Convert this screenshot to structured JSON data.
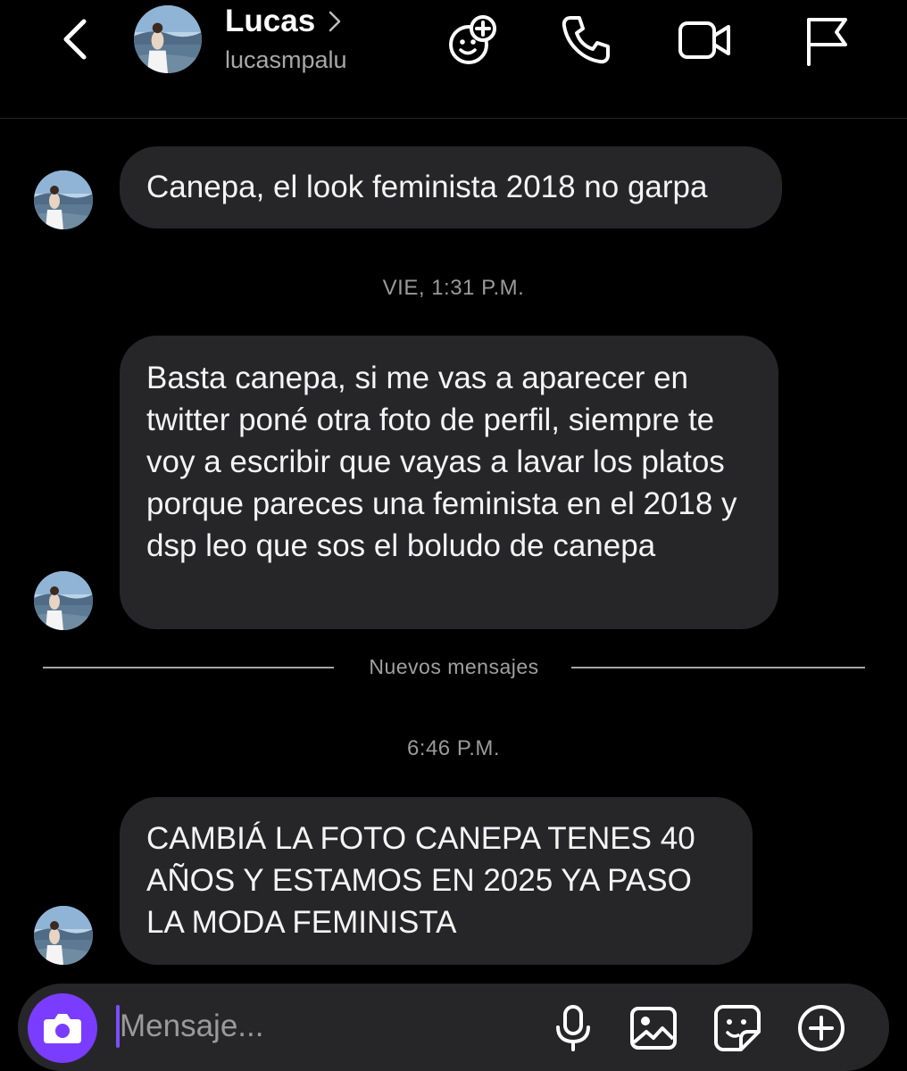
{
  "header": {
    "name": "Lucas",
    "username": "lucasmpalu",
    "icons": [
      "back-chevron-icon",
      "name-chevron-icon",
      "effects-icon",
      "phone-icon",
      "video-icon",
      "flag-icon"
    ]
  },
  "messages": [
    {
      "text": "Canepa, el look feminista 2018 no garpa"
    },
    {
      "text": "Basta canepa, si me vas a aparecer en twitter poné otra foto de perfil, siempre te voy a escribir que vayas a lavar los platos porque pareces una feminista en el 2018 y dsp leo que sos el boludo de canepa"
    },
    {
      "text": "CAMBIÁ LA FOTO CANEPA TENES 40 AÑOS Y ESTAMOS EN 2025 YA PASO LA MODA FEMINISTA"
    }
  ],
  "timestamps": {
    "first": "VIE, 1:31 P.M.",
    "second": "6:46 P.M."
  },
  "divider": {
    "label": "Nuevos mensajes"
  },
  "composer": {
    "placeholder": "Mensaje...",
    "value": "",
    "icons": [
      "camera-icon",
      "microphone-icon",
      "gallery-icon",
      "sticker-icon",
      "plus-icon"
    ]
  },
  "colors": {
    "background": "#000000",
    "bubble": "#262629",
    "accent": "#7a3cff",
    "secondary_text": "#a8a8a8"
  }
}
